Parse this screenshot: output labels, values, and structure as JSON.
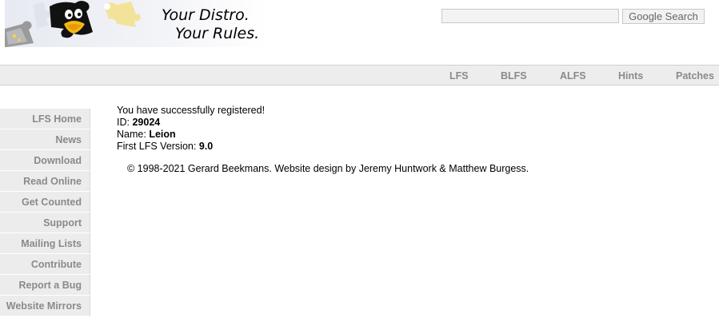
{
  "banner": {
    "slogan_line1": "Your Distro.",
    "slogan_line2": "Your Rules."
  },
  "search": {
    "query": "",
    "placeholder": "",
    "button_label": "Google Search"
  },
  "top_nav": [
    "LFS",
    "BLFS",
    "ALFS",
    "Hints",
    "Patches"
  ],
  "sidebar": {
    "items": [
      "LFS Home",
      "News",
      "Download",
      "Read Online",
      "Get Counted",
      "Support",
      "Mailing Lists",
      "Contribute",
      "Report a Bug",
      "Website Mirrors"
    ]
  },
  "registration": {
    "message": "You have successfully registered!",
    "id_label": "ID:",
    "id_value": "29024",
    "name_label": "Name:",
    "name_value": "Leion",
    "version_label": "First LFS Version:",
    "version_value": "9.0"
  },
  "footer": {
    "copyright": "© 1998-2021 Gerard Beekmans. Website design by Jeremy Huntwork & Matthew Burgess."
  },
  "colors": {
    "nav_background": "#ededed",
    "nav_text": "#8a8a8a",
    "sidebar_background": "#ececec"
  }
}
